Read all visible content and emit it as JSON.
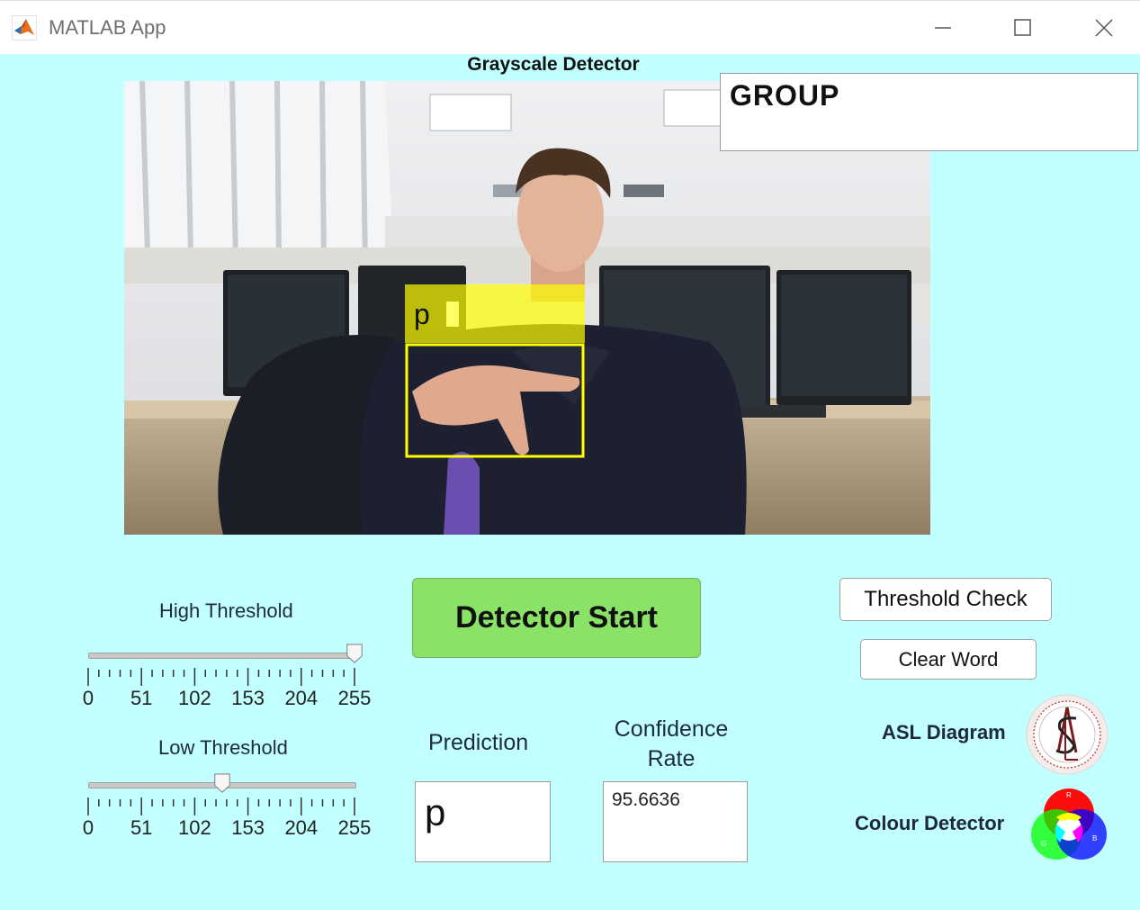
{
  "window": {
    "title": "MATLAB App",
    "icon": "matlab-icon",
    "controls": [
      "minimize-icon",
      "maximize-icon",
      "close-icon"
    ]
  },
  "panel": {
    "title": "Grayscale Detector"
  },
  "group": {
    "text": "GROUP"
  },
  "camera": {
    "detection_label": "p",
    "detection_color": "#ffff00"
  },
  "high_threshold": {
    "label": "High Threshold",
    "value": 255,
    "min": 0,
    "max": 255,
    "tick_labels": [
      "0",
      "51",
      "102",
      "153",
      "204",
      "255"
    ]
  },
  "low_threshold": {
    "label": "Low Threshold",
    "value": 128,
    "min": 0,
    "max": 255,
    "tick_labels": [
      "0",
      "51",
      "102",
      "153",
      "204",
      "255"
    ]
  },
  "buttons": {
    "detector_start": "Detector Start",
    "threshold_check": "Threshold Check",
    "clear_word": "Clear Word"
  },
  "prediction": {
    "label": "Prediction",
    "value": "p"
  },
  "confidence": {
    "label_line1": "Confidence",
    "label_line2": "Rate",
    "value": "95.6636"
  },
  "asl": {
    "label": "ASL Diagram",
    "icon": "asl-logo-icon"
  },
  "colour": {
    "label": "Colour Detector",
    "icon": "rgb-color-wheel-icon"
  },
  "colors": {
    "background": "#c2ffff",
    "start_button": "#8ae266",
    "detection_box": "#ffff00"
  }
}
